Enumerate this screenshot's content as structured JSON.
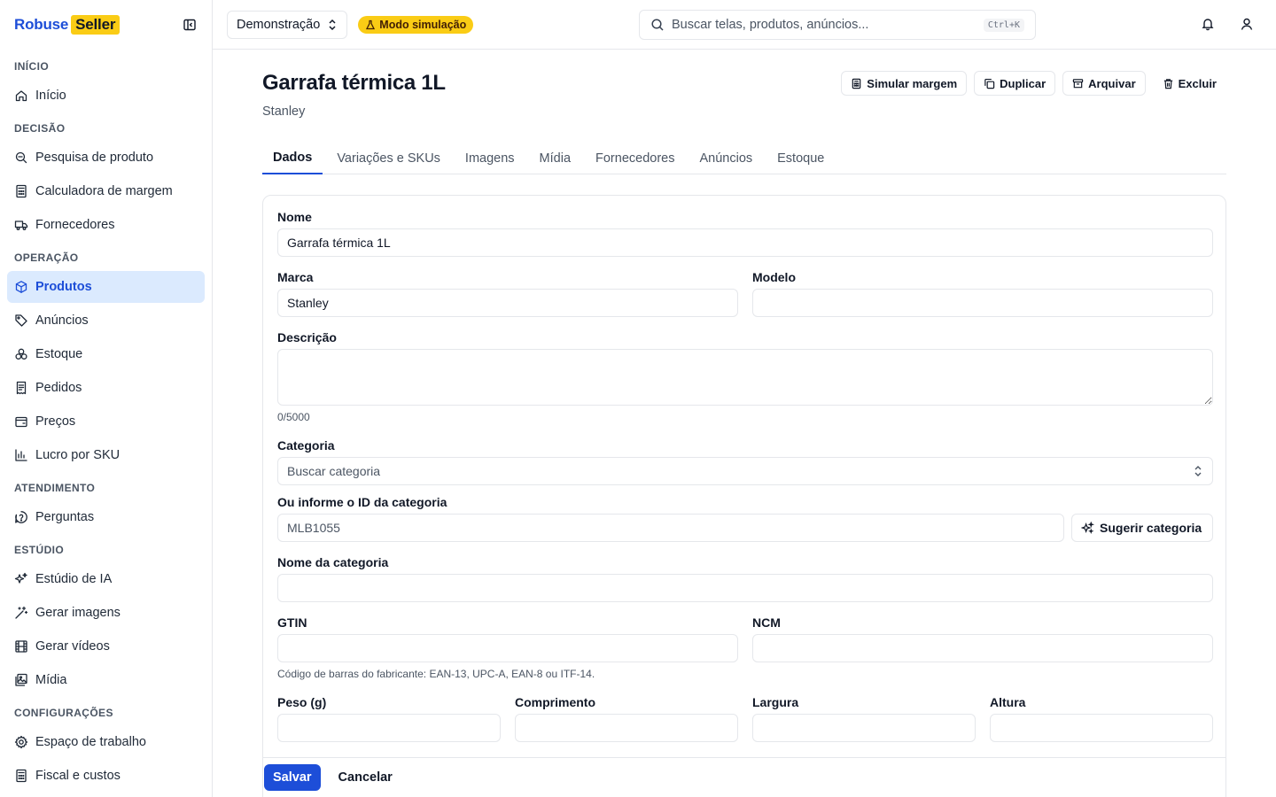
{
  "brand": {
    "name_a": "Robuse",
    "name_b": "Seller"
  },
  "sidebar": {
    "sections": [
      {
        "heading": "INÍCIO",
        "items": [
          {
            "label": "Início",
            "icon": "home-icon"
          }
        ]
      },
      {
        "heading": "DECISÃO",
        "items": [
          {
            "label": "Pesquisa de produto",
            "icon": "search-zoom-icon"
          },
          {
            "label": "Calculadora de margem",
            "icon": "calculator-icon"
          },
          {
            "label": "Fornecedores",
            "icon": "truck-icon"
          }
        ]
      },
      {
        "heading": "OPERAÇÃO",
        "items": [
          {
            "label": "Produtos",
            "icon": "package-icon",
            "active": true
          },
          {
            "label": "Anúncios",
            "icon": "tag-icon"
          },
          {
            "label": "Estoque",
            "icon": "boxes-icon"
          },
          {
            "label": "Pedidos",
            "icon": "receipt-icon"
          },
          {
            "label": "Preços",
            "icon": "wallet-icon"
          },
          {
            "label": "Lucro por SKU",
            "icon": "bar-chart-icon"
          }
        ]
      },
      {
        "heading": "ATENDIMENTO",
        "items": [
          {
            "label": "Perguntas",
            "icon": "question-bubble-icon"
          }
        ]
      },
      {
        "heading": "ESTÚDIO",
        "items": [
          {
            "label": "Estúdio de IA",
            "icon": "sparkles-icon"
          },
          {
            "label": "Gerar imagens",
            "icon": "magic-wand-icon"
          },
          {
            "label": "Gerar vídeos",
            "icon": "film-icon"
          },
          {
            "label": "Mídia",
            "icon": "images-icon"
          }
        ]
      },
      {
        "heading": "CONFIGURAÇÕES",
        "items": [
          {
            "label": "Espaço de trabalho",
            "icon": "gear-icon"
          },
          {
            "label": "Fiscal e custos",
            "icon": "calculator-icon"
          }
        ]
      }
    ]
  },
  "topbar": {
    "workspace": "Demonstração",
    "sim_badge": "Modo simulação",
    "search_placeholder": "Buscar telas, produtos, anúncios...",
    "shortcut": "Ctrl+K"
  },
  "product": {
    "title": "Garrafa térmica 1L",
    "brand": "Stanley",
    "actions": {
      "simulate": "Simular margem",
      "duplicate": "Duplicar",
      "archive": "Arquivar",
      "delete": "Excluir"
    }
  },
  "tabs": [
    {
      "label": "Dados",
      "active": true
    },
    {
      "label": "Variações e SKUs"
    },
    {
      "label": "Imagens"
    },
    {
      "label": "Mídia"
    },
    {
      "label": "Fornecedores"
    },
    {
      "label": "Anúncios"
    },
    {
      "label": "Estoque"
    }
  ],
  "form": {
    "name_label": "Nome",
    "name_value": "Garrafa térmica 1L",
    "brand_label": "Marca",
    "brand_value": "Stanley",
    "model_label": "Modelo",
    "model_value": "",
    "description_label": "Descrição",
    "description_counter": "0/5000",
    "category_label": "Categoria",
    "category_placeholder": "Buscar categoria",
    "category_id_label": "Ou informe o ID da categoria",
    "category_id_value": "MLB1055",
    "suggest_label": "Sugerir categoria",
    "category_name_label": "Nome da categoria",
    "gtin_label": "GTIN",
    "ncm_label": "NCM",
    "gtin_hint": "Código de barras do fabricante: EAN-13, UPC-A, EAN-8 ou ITF-14.",
    "weight_label": "Peso (g)",
    "length_label": "Comprimento",
    "width_label": "Largura",
    "height_label": "Altura"
  },
  "footer": {
    "save": "Salvar",
    "cancel": "Cancelar"
  }
}
